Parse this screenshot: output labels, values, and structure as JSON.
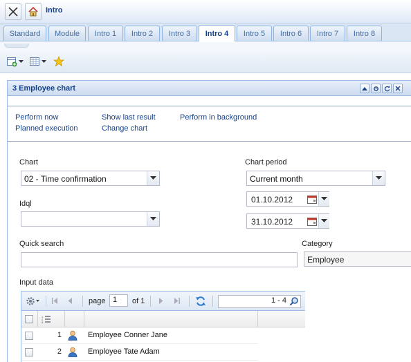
{
  "app": {
    "title": "Intro"
  },
  "tabs": [
    {
      "label": "Standard"
    },
    {
      "label": "Module"
    },
    {
      "label": "Intro 1"
    },
    {
      "label": "Intro 2"
    },
    {
      "label": "Intro 3"
    },
    {
      "label": "Intro 4"
    },
    {
      "label": "Intro 5"
    },
    {
      "label": "Intro 6"
    },
    {
      "label": "Intro 7"
    },
    {
      "label": "Intro 8"
    }
  ],
  "active_tab": "Intro 4",
  "panel": {
    "title": "3 Employee chart",
    "links": {
      "perform_now": "Perform now",
      "show_last_result": "Show last result",
      "perform_background": "Perform in background",
      "planned_execution": "Planned execution",
      "change_chart": "Change chart"
    }
  },
  "form": {
    "chart_label": "Chart",
    "chart_value": "02 - Time confirmation",
    "idql_label": "Idql",
    "idql_value": "",
    "chart_period_label": "Chart period",
    "chart_period_value": "Current month",
    "date_from": "01.10.2012",
    "date_to": "31.10.2012",
    "quick_search_label": "Quick search",
    "quick_search_value": "",
    "category_label": "Category",
    "category_value": "Employee"
  },
  "input_data": {
    "label": "Input data",
    "pager": {
      "page_label": "page",
      "page_value": "1",
      "of_label": "of 1",
      "range": "1 - 4"
    },
    "rows": [
      {
        "num": "1",
        "name": "Employee Conner Jane"
      },
      {
        "num": "2",
        "name": "Employee Tate Adam"
      }
    ]
  },
  "colors": {
    "accent": "#15428b",
    "border": "#99bbe8",
    "tab_bg": "#dae6f4"
  },
  "icons": [
    "close-icon",
    "home-icon",
    "add-view-icon",
    "table-view-icon",
    "favorite-star-icon",
    "collapse-up-icon",
    "settings-icon",
    "refresh-icon",
    "close-panel-icon",
    "calendar-icon",
    "chevron-down-icon",
    "gear-icon",
    "first-page-icon",
    "prev-page-icon",
    "next-page-icon",
    "last-page-icon",
    "reload-icon",
    "search-icon",
    "row-numbers-icon",
    "person-icon"
  ]
}
